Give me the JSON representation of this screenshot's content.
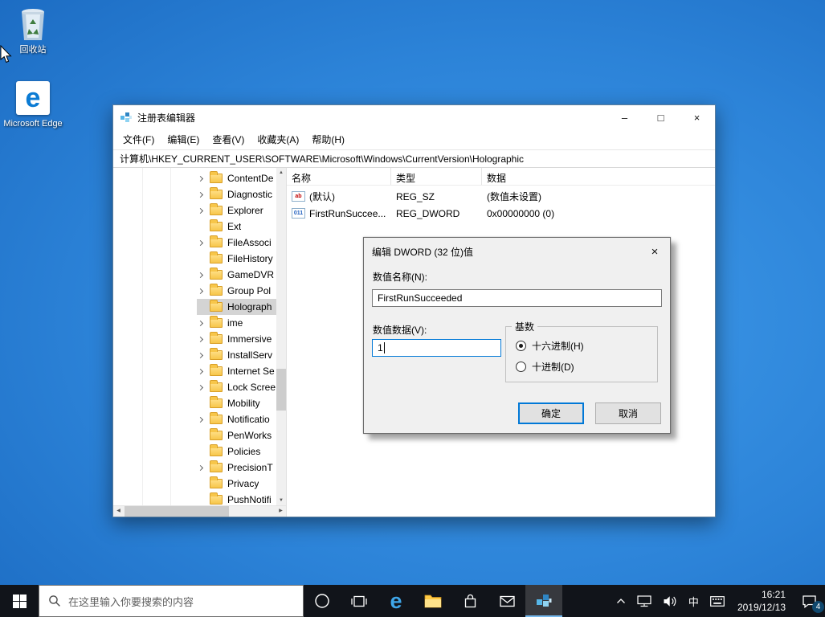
{
  "desktop": {
    "icons": [
      {
        "id": "recycle-bin",
        "label": "回收站"
      },
      {
        "id": "microsoft-edge",
        "label": "Microsoft Edge"
      }
    ]
  },
  "regedit": {
    "title": "注册表编辑器",
    "window_controls": {
      "minimize": "–",
      "maximize": "□",
      "close": "×"
    },
    "menus": [
      {
        "id": "file",
        "label": "文件(F)"
      },
      {
        "id": "edit",
        "label": "编辑(E)"
      },
      {
        "id": "view",
        "label": "查看(V)"
      },
      {
        "id": "favorites",
        "label": "收藏夹(A)"
      },
      {
        "id": "help",
        "label": "帮助(H)"
      }
    ],
    "address": "计算机\\HKEY_CURRENT_USER\\SOFTWARE\\Microsoft\\Windows\\CurrentVersion\\Holographic",
    "tree_items": [
      {
        "id": "contentdelivery",
        "label": "ContentDe",
        "chevron": true,
        "selected": false
      },
      {
        "id": "diagnostics",
        "label": "Diagnostic",
        "chevron": true,
        "selected": false
      },
      {
        "id": "explorer",
        "label": "Explorer",
        "chevron": true,
        "selected": false
      },
      {
        "id": "ext",
        "label": "Ext",
        "chevron": false,
        "selected": false
      },
      {
        "id": "fileassociations",
        "label": "FileAssoci",
        "chevron": true,
        "selected": false
      },
      {
        "id": "filehistory",
        "label": "FileHistory",
        "chevron": false,
        "selected": false
      },
      {
        "id": "gamedvr",
        "label": "GameDVR",
        "chevron": true,
        "selected": false
      },
      {
        "id": "grouppolicy",
        "label": "Group Pol",
        "chevron": true,
        "selected": false
      },
      {
        "id": "holographic",
        "label": "Holograph",
        "chevron": false,
        "selected": true
      },
      {
        "id": "ime",
        "label": "ime",
        "chevron": true,
        "selected": false
      },
      {
        "id": "immersiveshell",
        "label": "Immersive",
        "chevron": true,
        "selected": false
      },
      {
        "id": "installservice",
        "label": "InstallServ",
        "chevron": true,
        "selected": false
      },
      {
        "id": "internetsettings",
        "label": "Internet Se",
        "chevron": true,
        "selected": false
      },
      {
        "id": "lockscreen",
        "label": "Lock Scree",
        "chevron": true,
        "selected": false
      },
      {
        "id": "mobility",
        "label": "Mobility",
        "chevron": false,
        "selected": false
      },
      {
        "id": "notifications",
        "label": "Notificatio",
        "chevron": true,
        "selected": false
      },
      {
        "id": "penworkspace",
        "label": "PenWorks",
        "chevron": false,
        "selected": false
      },
      {
        "id": "policies",
        "label": "Policies",
        "chevron": false,
        "selected": false
      },
      {
        "id": "precisiontouchpad",
        "label": "PrecisionT",
        "chevron": true,
        "selected": false
      },
      {
        "id": "privacy",
        "label": "Privacy",
        "chevron": false,
        "selected": false
      },
      {
        "id": "pushnotifications",
        "label": "PushNotifi",
        "chevron": false,
        "selected": false
      }
    ],
    "list": {
      "columns": [
        {
          "id": "name",
          "label": "名称"
        },
        {
          "id": "type",
          "label": "类型"
        },
        {
          "id": "data",
          "label": "数据"
        }
      ],
      "rows": [
        {
          "icon": "string",
          "icon_text": "ab",
          "name": "(默认)",
          "type": "REG_SZ",
          "data": "(数值未设置)"
        },
        {
          "icon": "dword",
          "icon_text": "011",
          "name": "FirstRunSuccee...",
          "type": "REG_DWORD",
          "data": "0x00000000 (0)"
        }
      ]
    }
  },
  "dialog": {
    "title": "编辑 DWORD (32 位)值",
    "close": "×",
    "value_name_label": "数值名称(N):",
    "value_name": "FirstRunSucceeded",
    "value_data_label": "数值数据(V):",
    "value_data": "1",
    "base_label": "基数",
    "radios": [
      {
        "id": "hex",
        "label": "十六进制(H)",
        "checked": true
      },
      {
        "id": "dec",
        "label": "十进制(D)",
        "checked": false
      }
    ],
    "ok_label": "确定",
    "cancel_label": "取消"
  },
  "taskbar": {
    "search_placeholder": "在这里输入你要搜索的内容",
    "app_icons": [
      "start",
      "cortana",
      "task-view",
      "edge",
      "file-explorer",
      "store",
      "mail",
      "regedit"
    ],
    "active_app": "regedit",
    "tray": {
      "language": "中",
      "time": "16:21",
      "date": "2019/12/13",
      "notification_count": "4"
    }
  },
  "colors": {
    "accent": "#0078d7",
    "selection": "#d4d4d4",
    "taskbar": "#11141a",
    "desktop_blue": "#2c83d8"
  }
}
